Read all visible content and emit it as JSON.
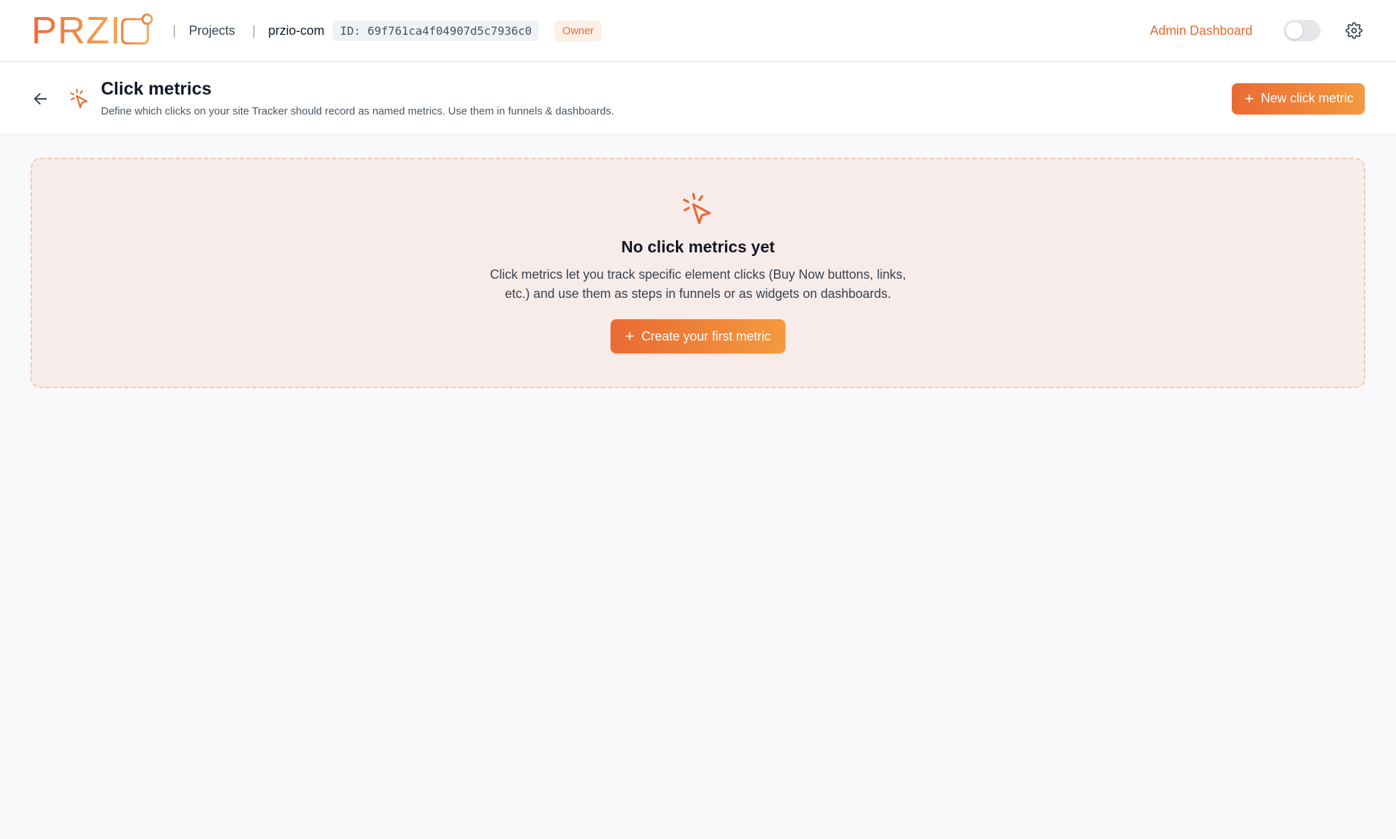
{
  "nav": {
    "logo_text": "PRZI",
    "separator": "|",
    "projects_label": "Projects",
    "project_name": "przio-com",
    "project_id": "ID: 69f761ca4f04907d5c7936c0",
    "role_badge": "Owner",
    "admin_link": "Admin Dashboard",
    "theme_toggle_on": false
  },
  "header": {
    "title": "Click metrics",
    "subtitle": "Define which clicks on your site Tracker should record as named metrics. Use them in funnels & dashboards.",
    "new_button_label": "New click metric",
    "plus_symbol": "+"
  },
  "empty_state": {
    "title": "No click metrics yet",
    "description": "Click metrics let you track specific element clicks (Buy Now buttons, links, etc.) and use them as steps in funnels or as widgets on dashboards.",
    "cta_label": "Create your first metric"
  },
  "icons": {
    "logo": "note-icon",
    "back": "arrow-left-icon",
    "header": "cursor-click-icon",
    "settings": "gear-icon",
    "empty": "cursor-click-icon"
  },
  "colors": {
    "accent": "#ea6a33",
    "accent_end": "#f39a3f",
    "empty_bg": "#f7ecea",
    "empty_border": "#f5c6b0"
  }
}
